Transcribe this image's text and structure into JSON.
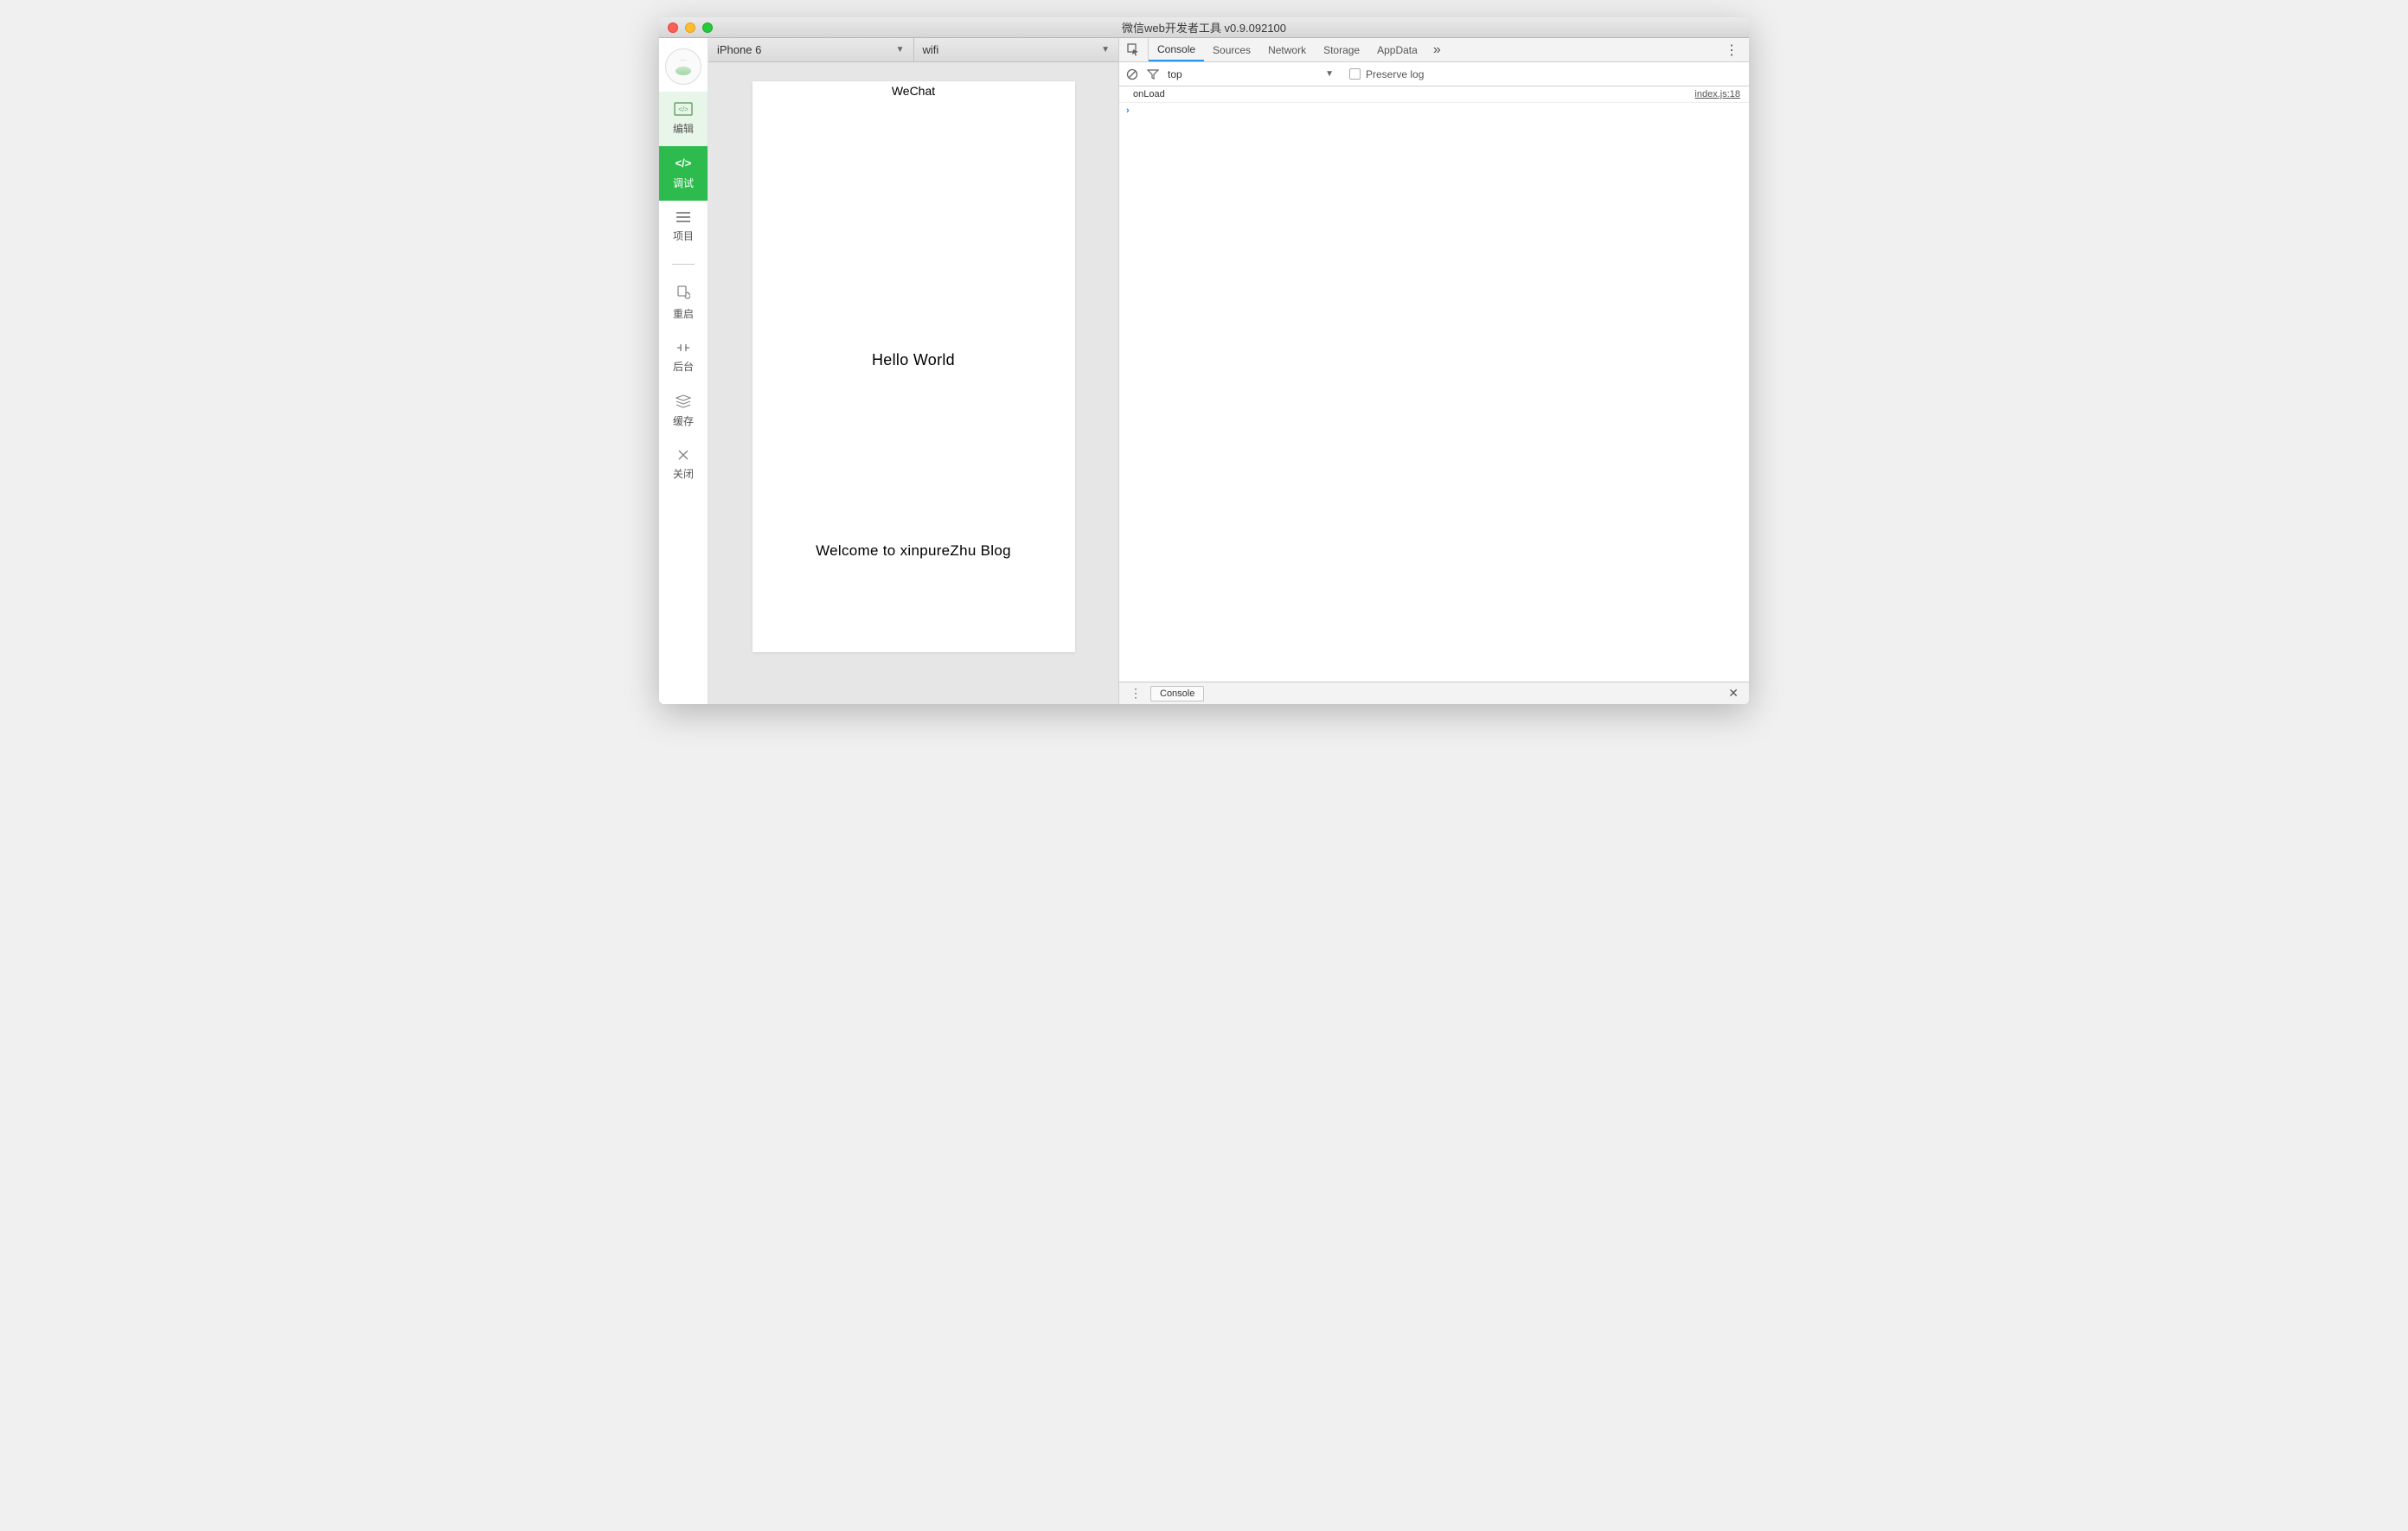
{
  "window": {
    "title": "微信web开发者工具 v0.9.092100"
  },
  "sidebar": {
    "items": [
      {
        "id": "edit",
        "label": "编辑"
      },
      {
        "id": "debug",
        "label": "调试"
      },
      {
        "id": "project",
        "label": "项目"
      }
    ],
    "tools": [
      {
        "id": "restart",
        "label": "重启"
      },
      {
        "id": "background",
        "label": "后台"
      },
      {
        "id": "cache",
        "label": "缓存"
      },
      {
        "id": "close",
        "label": "关闭"
      }
    ]
  },
  "preview": {
    "device_dropdown": "iPhone 6",
    "network_dropdown": "wifi",
    "statusbar_title": "WeChat",
    "content": {
      "hello": "Hello World",
      "welcome": "Welcome to xinpureZhu Blog"
    }
  },
  "devtools": {
    "tabs": [
      "Console",
      "Sources",
      "Network",
      "Storage",
      "AppData"
    ],
    "active_tab": "Console",
    "overflow": "»",
    "filter": {
      "context": "top",
      "preserve_log_label": "Preserve log"
    },
    "console": {
      "messages": [
        {
          "text": "onLoad",
          "source": "index.js:18"
        }
      ],
      "prompt": "›"
    },
    "footer": {
      "drawer_label": "Console"
    }
  }
}
